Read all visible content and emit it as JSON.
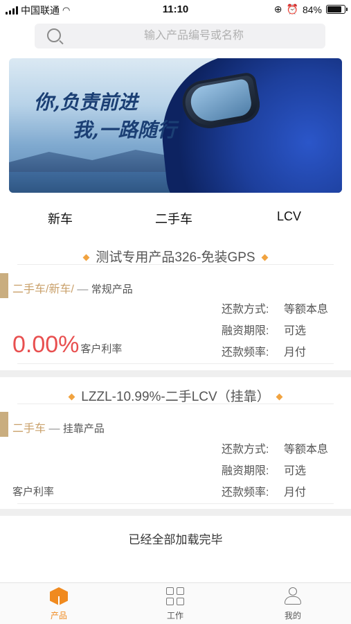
{
  "status_bar": {
    "carrier": "中国联通",
    "time": "11:10",
    "battery": "84%",
    "battery_level": 0.84
  },
  "search": {
    "placeholder": "输入产品编号或名称"
  },
  "banner": {
    "line1": "你,负责前进",
    "line2": "我,一路随行"
  },
  "tabs": [
    "新车",
    "二手车",
    "LCV"
  ],
  "products": [
    {
      "title": "测试专用产品326-免装GPS",
      "category_tag": "二手车/新车/",
      "category_sep": " — ",
      "category_type": "常规产品",
      "rate": "0.00%",
      "rate_label": "客户利率",
      "terms": [
        {
          "label": "还款方式:",
          "value": "等额本息"
        },
        {
          "label": "融资期限:",
          "value": "可选"
        },
        {
          "label": "还款频率:",
          "value": "月付"
        }
      ]
    },
    {
      "title": "LZZL-10.99%-二手LCV（挂靠）",
      "category_tag": "二手车",
      "category_sep": " — ",
      "category_type": "挂靠产品",
      "rate": "",
      "rate_label": "客户利率",
      "terms": [
        {
          "label": "还款方式:",
          "value": "等额本息"
        },
        {
          "label": "融资期限:",
          "value": "可选"
        },
        {
          "label": "还款频率:",
          "value": "月付"
        }
      ]
    }
  ],
  "footer_text": "已经全部加载完毕",
  "tabbar": {
    "product": "产品",
    "work": "工作",
    "mine": "我的"
  },
  "colors": {
    "accent": "#f08a1f",
    "rate_red": "#e84f4f",
    "tag_gold": "#c9a06a"
  }
}
